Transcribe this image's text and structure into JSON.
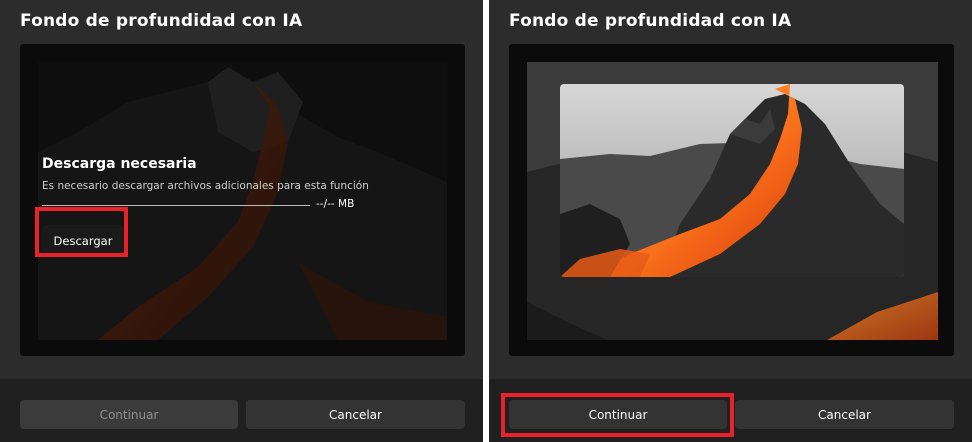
{
  "left": {
    "title": "Fondo de profundidad con IA",
    "download": {
      "heading": "Descarga necesaria",
      "description": "Es necesario descargar archivos adicionales para esta función",
      "progress_text": "--/-- MB",
      "button_label": "Descargar"
    },
    "footer": {
      "continue_label": "Continuar",
      "cancel_label": "Cancelar"
    }
  },
  "right": {
    "title": "Fondo de profundidad con IA",
    "footer": {
      "continue_label": "Continuar",
      "cancel_label": "Cancelar"
    }
  },
  "colors": {
    "panel_bg": "#2c2c2c",
    "footer_bg": "#202020",
    "highlight": "#e8212b",
    "lava": "#ff6a1a"
  }
}
